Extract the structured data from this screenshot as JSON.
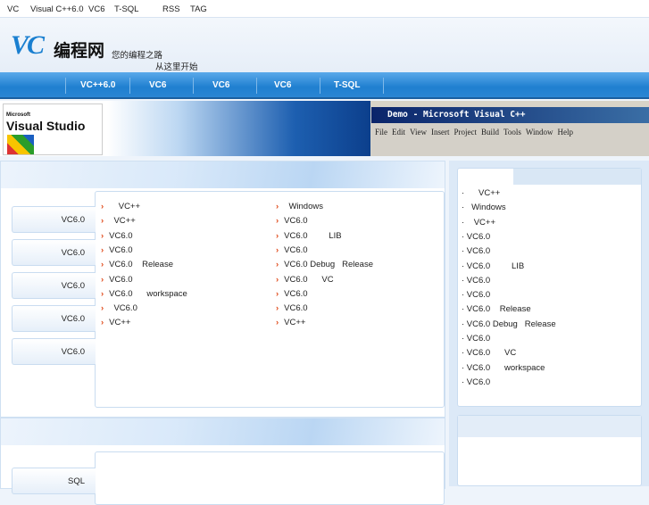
{
  "topbar": [
    "VC",
    "Visual C++6.0",
    "VC6",
    "T-SQL",
    "RSS",
    "TAG"
  ],
  "logo": {
    "vc": "VC",
    "name": "编程网"
  },
  "slogan": [
    "您的编程之路",
    "从这里开始"
  ],
  "nav": [
    "VC++6.0",
    "VC6",
    "VC6",
    "VC6",
    "T-SQL"
  ],
  "banner": {
    "vs_title": "Visual Studio",
    "vs_brand": "Microsoft",
    "window_title": "Demo - Microsoft Visual C++",
    "menu": [
      "File",
      "Edit",
      "View",
      "Insert",
      "Project",
      "Build",
      "Tools",
      "Window",
      "Help"
    ]
  },
  "left_tabs": [
    "VC6.0",
    "VC6.0",
    "VC6.0",
    "VC6.0",
    "VC6.0"
  ],
  "list_col1": [
    "    VC++",
    "  VC++",
    "VC6.0",
    "VC6.0",
    "VC6.0    Release",
    "VC6.0",
    "VC6.0      workspace",
    "  VC6.0",
    "VC++"
  ],
  "list_col2": [
    "  Windows",
    "VC6.0",
    "VC6.0         LIB",
    "VC6.0",
    "VC6.0 Debug   Release",
    "VC6.0      VC",
    "VC6.0",
    "VC6.0",
    "VC++"
  ],
  "right_list": [
    "·      VC++",
    "·   Windows",
    "·    VC++",
    "· VC6.0",
    "· VC6.0",
    "· VC6.0         LIB",
    "· VC6.0",
    "· VC6.0",
    "· VC6.0    Release",
    "· VC6.0 Debug   Release",
    "· VC6.0",
    "· VC6.0      VC",
    "· VC6.0      workspace",
    "· VC6.0"
  ],
  "second_panel": {
    "tab": "SQL"
  }
}
